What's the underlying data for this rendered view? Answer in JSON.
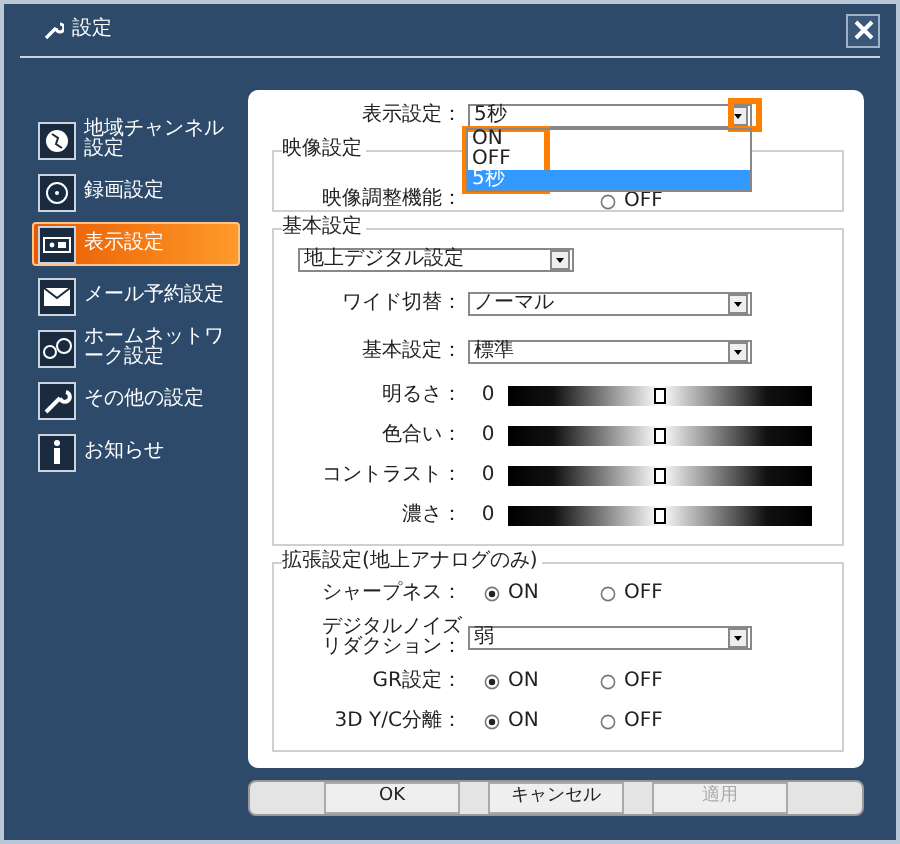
{
  "window": {
    "title": "設定"
  },
  "sidebar": {
    "items": [
      {
        "label": "地域チャンネル設定",
        "selected": false
      },
      {
        "label": "録画設定",
        "selected": false
      },
      {
        "label": "表示設定",
        "selected": true
      },
      {
        "label": "メール予約設定",
        "selected": false
      },
      {
        "label": "ホームネットワーク設定",
        "selected": false
      },
      {
        "label": "その他の設定",
        "selected": false
      },
      {
        "label": "お知らせ",
        "selected": false
      }
    ]
  },
  "display_setting": {
    "label": "表示設定：",
    "value": "5秒",
    "expanded": true,
    "options": [
      {
        "label": "ON",
        "selected": false
      },
      {
        "label": "OFF",
        "selected": false
      },
      {
        "label": "5秒",
        "selected": true
      }
    ]
  },
  "video_settings": {
    "legend": "映像設定",
    "rows": [
      {
        "kind": "radio",
        "label": "映像調整機能：",
        "options": [
          {
            "label": "OFF",
            "selected": false
          }
        ]
      }
    ]
  },
  "basic_settings": {
    "legend": "基本設定",
    "source": {
      "value": "地上デジタル設定"
    },
    "rows": [
      {
        "kind": "select",
        "label": "ワイド切替：",
        "value": "ノーマル"
      },
      {
        "kind": "select",
        "label": "基本設定：",
        "value": "標準"
      },
      {
        "kind": "slider",
        "label": "明るさ：",
        "reading": "0",
        "level": 0.5
      },
      {
        "kind": "slider",
        "label": "色合い：",
        "reading": "0",
        "level": 0.5
      },
      {
        "kind": "slider",
        "label": "コントラスト：",
        "reading": "0",
        "level": 0.5
      },
      {
        "kind": "slider",
        "label": "濃さ：",
        "reading": "0",
        "level": 0.5
      }
    ]
  },
  "extended_settings": {
    "legend": "拡張設定(地上アナログのみ)",
    "rows": [
      {
        "kind": "radio",
        "label": "シャープネス：",
        "options": [
          {
            "label": "ON",
            "selected": true
          },
          {
            "label": "OFF",
            "selected": false
          }
        ]
      },
      {
        "kind": "select",
        "label": "デジタルノイズリダクション：",
        "value": "弱"
      },
      {
        "kind": "radio",
        "label": "GR設定：",
        "options": [
          {
            "label": "ON",
            "selected": true
          },
          {
            "label": "OFF",
            "selected": false
          }
        ]
      },
      {
        "kind": "radio",
        "label": "3D Y/C分離：",
        "options": [
          {
            "label": "ON",
            "selected": true
          },
          {
            "label": "OFF",
            "selected": false
          }
        ]
      }
    ]
  },
  "buttons": [
    {
      "label": "OK",
      "disabled": false
    },
    {
      "label": "キャンセル",
      "disabled": false
    },
    {
      "label": "適用",
      "disabled": true
    }
  ]
}
